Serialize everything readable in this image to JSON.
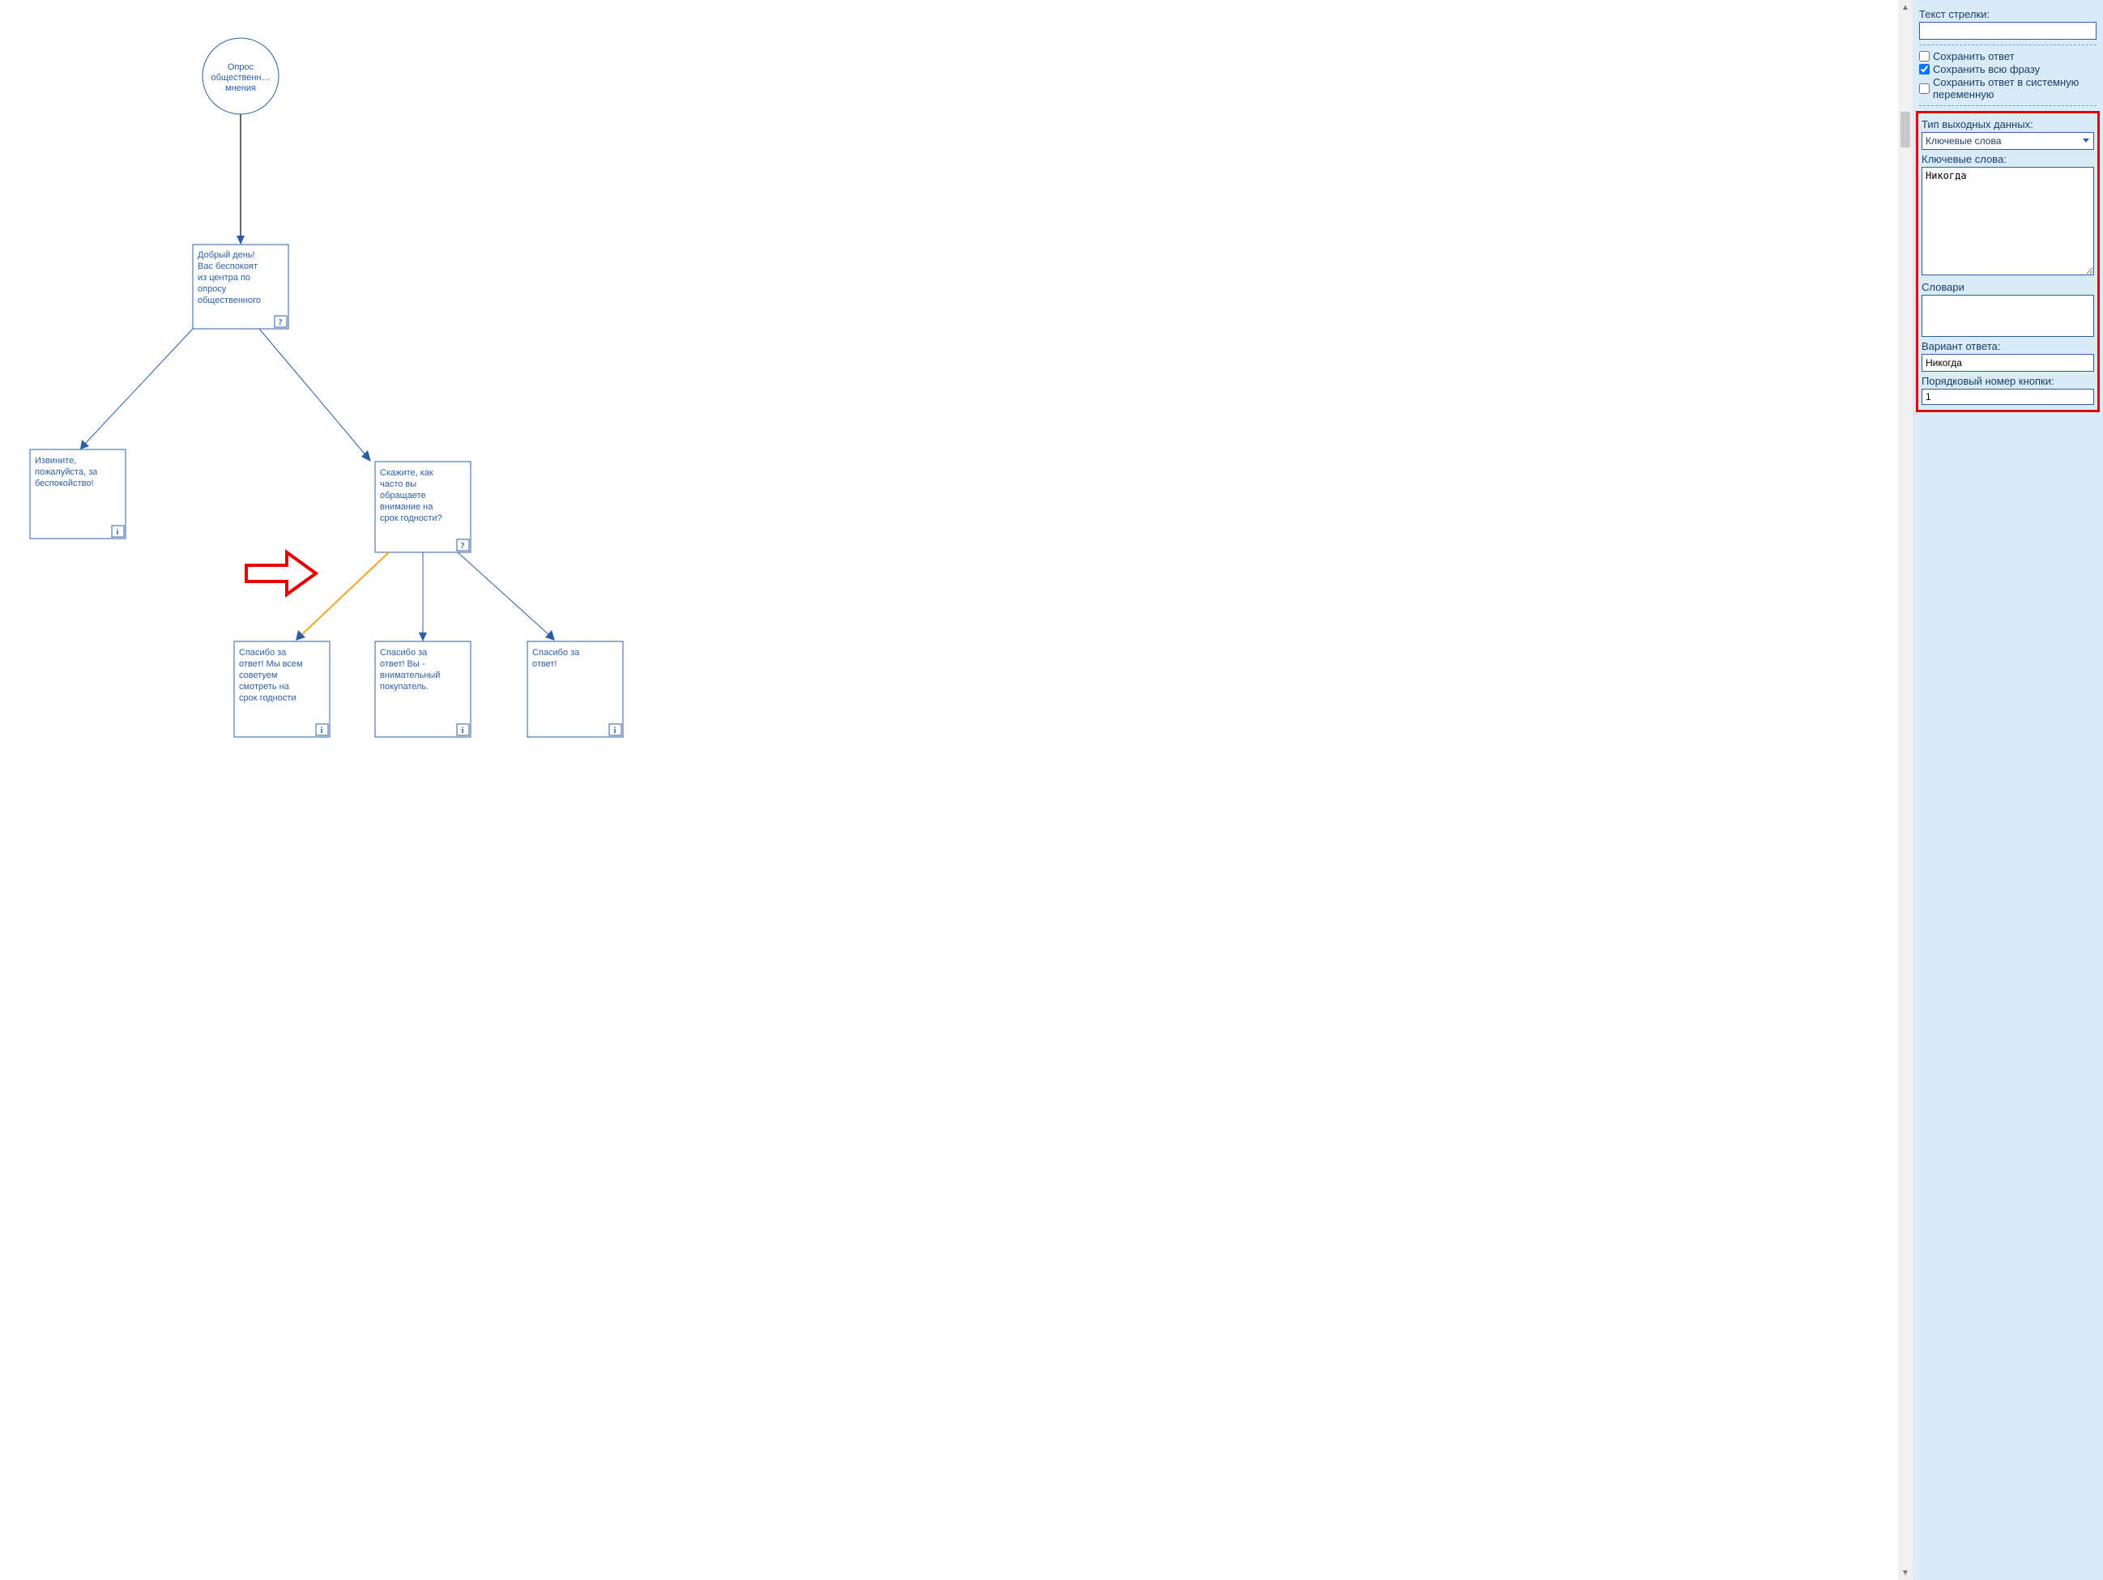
{
  "canvas": {
    "start_node": "Опрос общественн… мнения",
    "node_greeting": "Добрый день! Вас беспокоят из центра по опросу общественного",
    "node_apology": "Извините, пожалуйста, за беспокойство!",
    "node_question": "Скажите, как часто вы обращаете внимание на срок годности?",
    "node_ans1": "Спасибо за ответ! Мы всем советуем смотреть на срок годности",
    "node_ans2": "Спасибо за ответ! Вы - внимательный покупатель.",
    "node_ans3": "Спасибо за ответ!",
    "icon_q": "?",
    "icon_i": "i"
  },
  "panel": {
    "arrow_text_label": "Текст стрелки:",
    "arrow_text_value": "",
    "cb_save_answer": "Сохранить ответ",
    "cb_save_phrase": "Сохранить всю фразу",
    "cb_save_sysvar": "Сохранить ответ в системную переменную",
    "output_type_label": "Тип выходных данных:",
    "output_type_value": "Ключевые слова",
    "keywords_label": "Ключевые слова:",
    "keywords_value": "Никогда",
    "dicts_label": "Словари",
    "answer_variant_label": "Вариант ответа:",
    "answer_variant_value": "Никогда",
    "button_order_label": "Порядковый номер кнопки:",
    "button_order_value": "1"
  }
}
